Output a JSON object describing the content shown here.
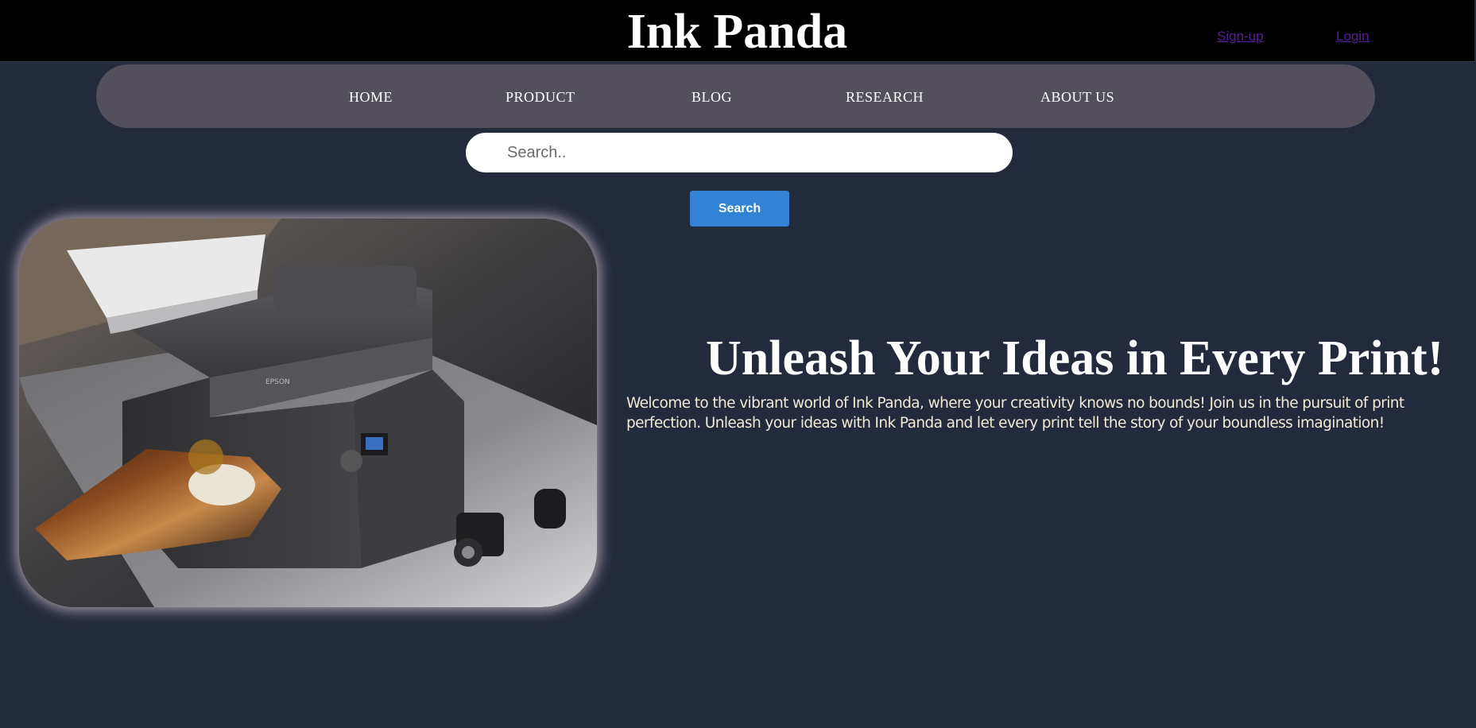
{
  "header": {
    "brand": "Ink Panda",
    "signup_label": "Sign-up",
    "login_label": "Login"
  },
  "nav": {
    "items": [
      {
        "label": "HOME"
      },
      {
        "label": "PRODUCT"
      },
      {
        "label": "BLOG"
      },
      {
        "label": "RESEARCH"
      },
      {
        "label": "ABOUT US"
      }
    ]
  },
  "search": {
    "placeholder": "Search..",
    "value": "",
    "button_label": "Search"
  },
  "hero": {
    "image_icon": "printer-product-photo",
    "printer_brand_text": "EPSON",
    "headline": "Unleash Your Ideas in Every Print!",
    "intro": "Welcome to the vibrant world of Ink Panda, where your creativity knows no bounds! Join us in the pursuit of print perfection. Unleash your ideas with Ink Panda and let every print tell the story of your boundless imagination!"
  },
  "colors": {
    "page_bg": "#232a3c",
    "header_bg": "#000000",
    "nav_bg": "#53505c",
    "accent": "#3282d6",
    "link": "#5a1e9e"
  }
}
